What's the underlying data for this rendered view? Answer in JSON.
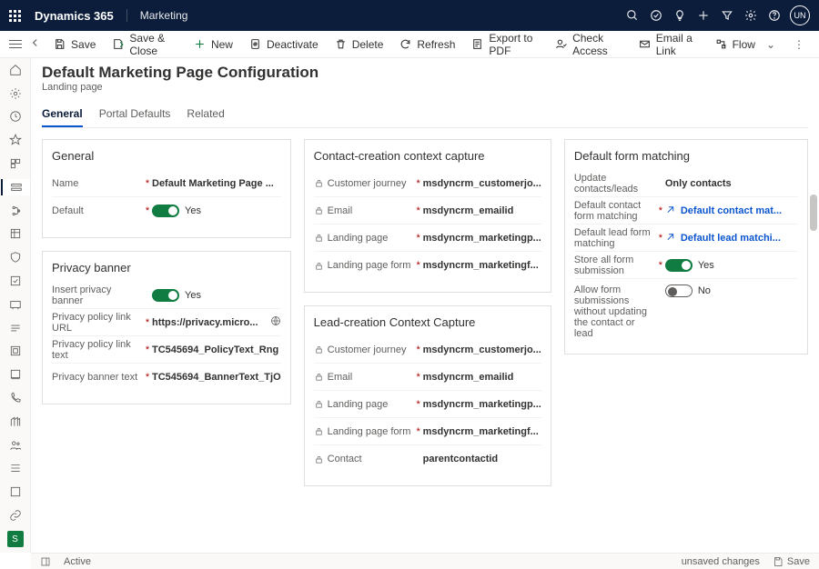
{
  "brand": "Dynamics 365",
  "app": "Marketing",
  "avatar": "UN",
  "commands": {
    "save": "Save",
    "saveClose": "Save & Close",
    "new": "New",
    "deactivate": "Deactivate",
    "delete": "Delete",
    "refresh": "Refresh",
    "exportPdf": "Export to PDF",
    "checkAccess": "Check Access",
    "emailLink": "Email a Link",
    "flow": "Flow"
  },
  "page": {
    "title": "Default Marketing Page Configuration",
    "subtitle": "Landing page"
  },
  "tabs": {
    "general": "General",
    "portal": "Portal Defaults",
    "related": "Related"
  },
  "general": {
    "heading": "General",
    "name_label": "Name",
    "name_value": "Default Marketing Page ...",
    "default_label": "Default",
    "default_value": "Yes"
  },
  "privacy": {
    "heading": "Privacy banner",
    "insert_label": "Insert privacy banner",
    "insert_value": "Yes",
    "url_label": "Privacy policy link URL",
    "url_value": "https://privacy.micro...",
    "text_label": "Privacy policy link text",
    "text_value": "TC545694_PolicyText_Rng",
    "banner_label": "Privacy banner text",
    "banner_value": "TC545694_BannerText_TjO"
  },
  "contactCap": {
    "heading": "Contact-creation context capture",
    "rows": [
      {
        "label": "Customer journey",
        "value": "msdyncrm_customerjo..."
      },
      {
        "label": "Email",
        "value": "msdyncrm_emailid"
      },
      {
        "label": "Landing page",
        "value": "msdyncrm_marketingp..."
      },
      {
        "label": "Landing page form",
        "value": "msdyncrm_marketingf..."
      }
    ]
  },
  "leadCap": {
    "heading": "Lead-creation Context Capture",
    "rows": [
      {
        "label": "Customer journey",
        "value": "msdyncrm_customerjo..."
      },
      {
        "label": "Email",
        "value": "msdyncrm_emailid"
      },
      {
        "label": "Landing page",
        "value": "msdyncrm_marketingp..."
      },
      {
        "label": "Landing page form",
        "value": "msdyncrm_marketingf..."
      },
      {
        "label": "Contact",
        "value": "parentcontactid"
      }
    ]
  },
  "formMatch": {
    "heading": "Default form matching",
    "update_label": "Update contacts/leads",
    "update_value": "Only contacts",
    "contact_label": "Default contact form matching",
    "contact_value": "Default contact mat...",
    "lead_label": "Default lead form matching",
    "lead_value": "Default lead matchi...",
    "store_label": "Store all form submission",
    "store_value": "Yes",
    "allow_label": "Allow form submissions without updating the contact or lead",
    "allow_value": "No"
  },
  "status": {
    "active": "Active",
    "unsaved": "unsaved changes",
    "save": "Save"
  }
}
